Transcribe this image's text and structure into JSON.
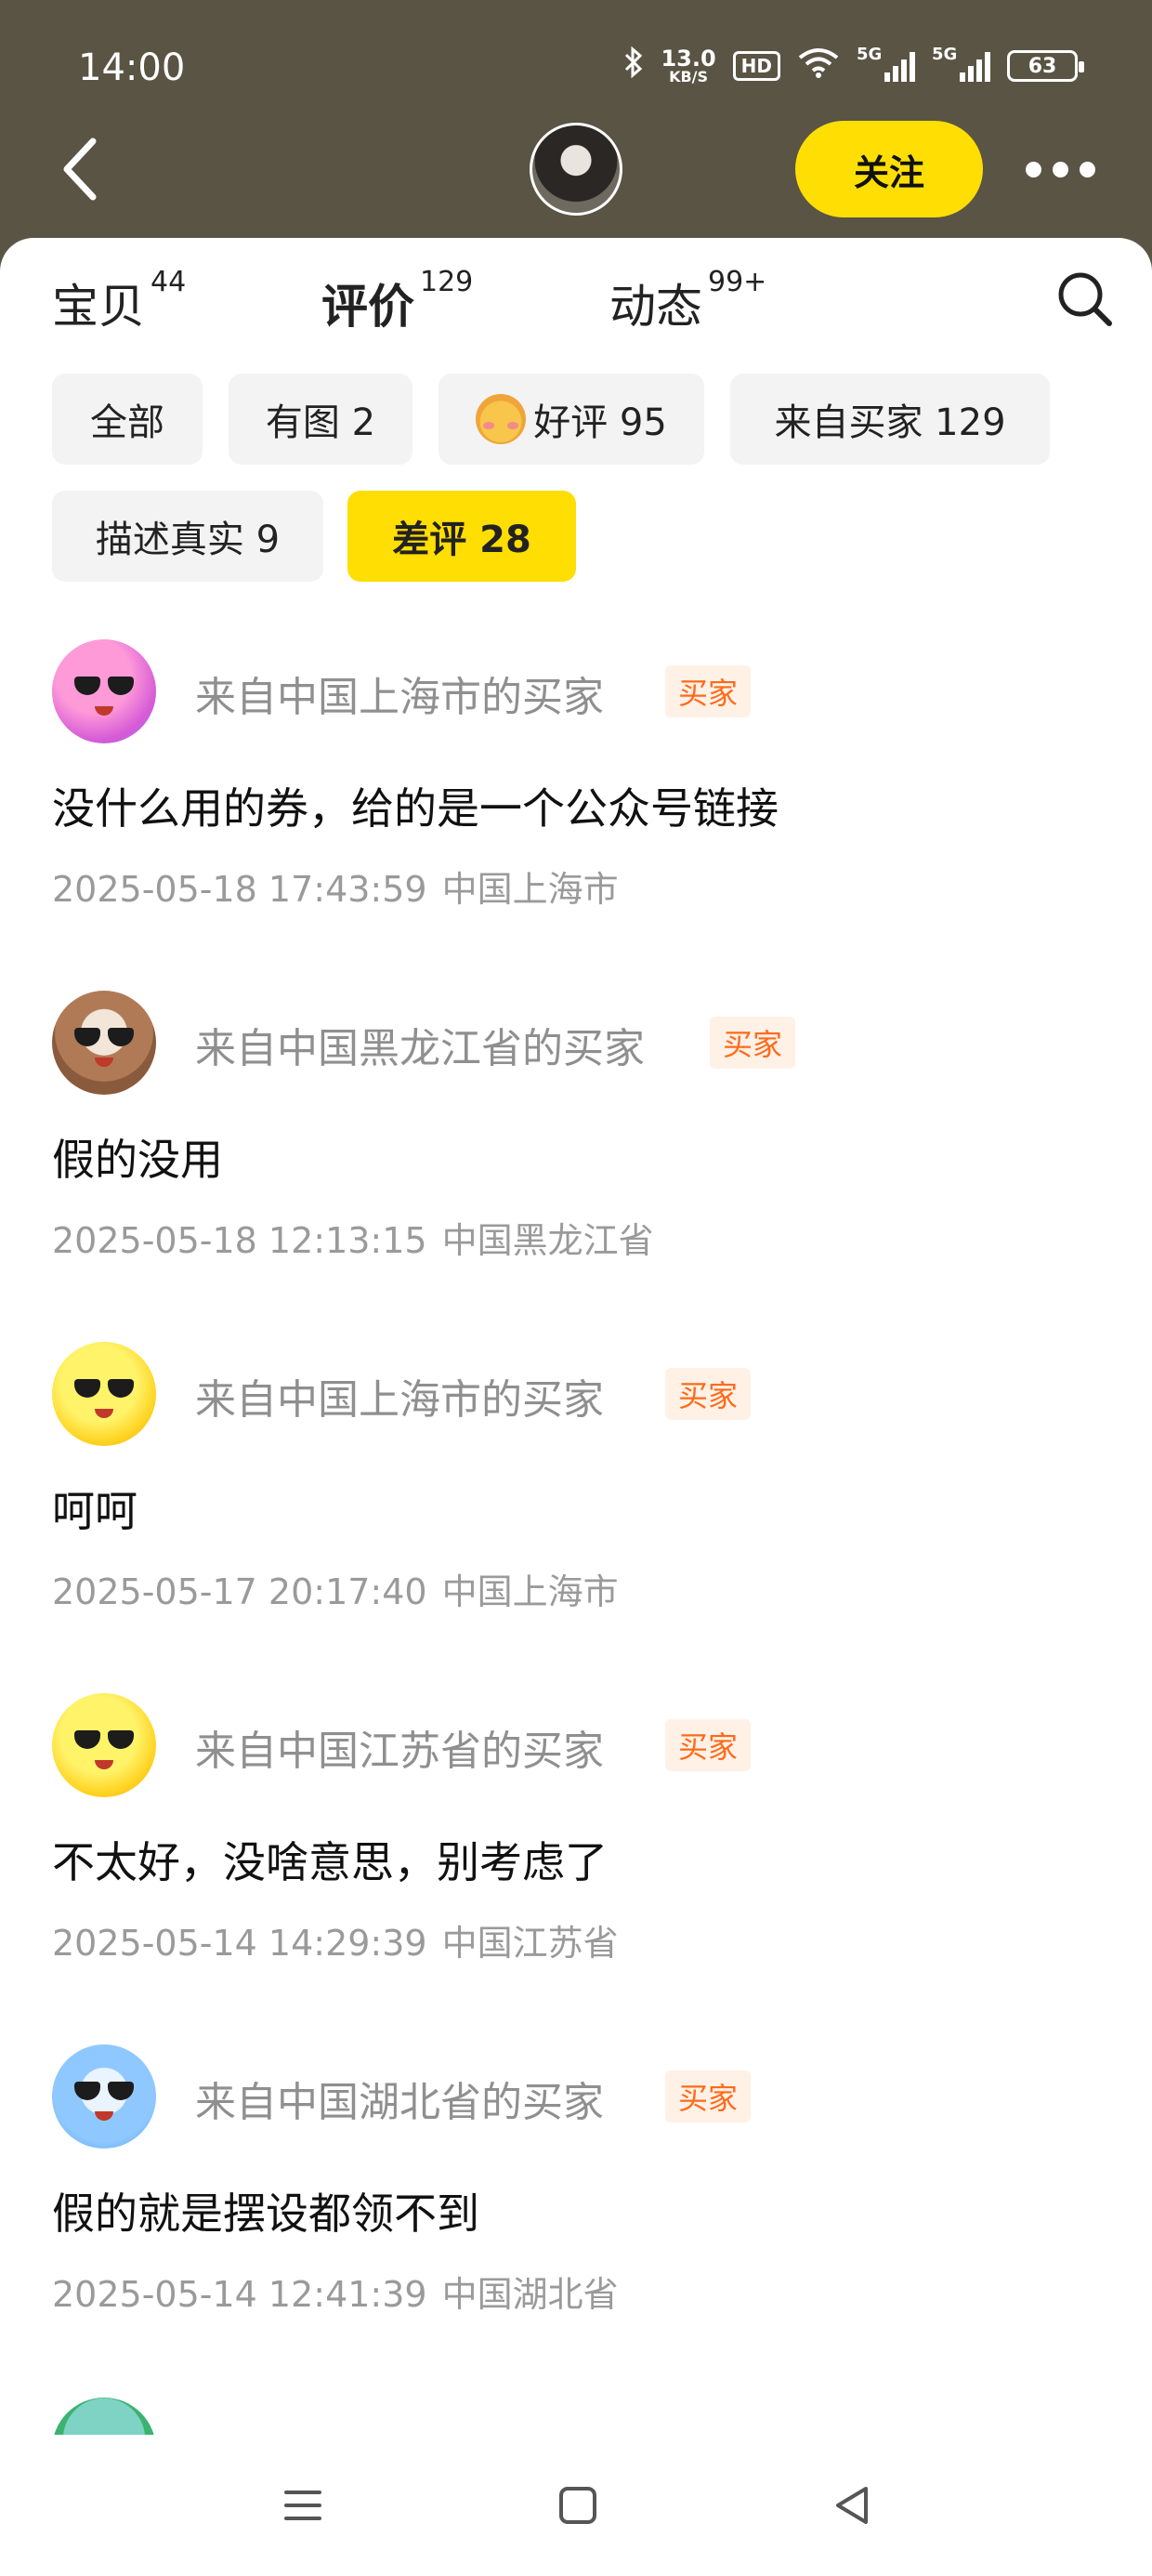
{
  "status_bar": {
    "time": "14:00",
    "net_speed_value": "13.0",
    "net_speed_unit": "KB/S",
    "hd_label": "HD",
    "signal1_label": "5G",
    "signal2_label": "5G",
    "battery": "63"
  },
  "header": {
    "follow_label": "关注"
  },
  "tabs": [
    {
      "label": "宝贝",
      "count": "44"
    },
    {
      "label": "评价",
      "count": "129"
    },
    {
      "label": "动态",
      "count": "99+"
    }
  ],
  "filters": [
    {
      "label": "全部"
    },
    {
      "label": "有图 2"
    },
    {
      "label": "好评 95"
    },
    {
      "label": "来自买家 129"
    },
    {
      "label": "描述真实 9"
    },
    {
      "label": "差评 28"
    }
  ],
  "reviews": [
    {
      "name": "来自中国上海市的买家",
      "badge": "买家",
      "text": "没什么用的券，给的是一个公众号链接",
      "time": "2025-05-18 17:43:59",
      "location": "中国上海市"
    },
    {
      "name": "来自中国黑龙江省的买家",
      "badge": "买家",
      "text": "假的没用",
      "time": "2025-05-18 12:13:15",
      "location": "中国黑龙江省"
    },
    {
      "name": "来自中国上海市的买家",
      "badge": "买家",
      "text": "呵呵",
      "time": "2025-05-17 20:17:40",
      "location": "中国上海市"
    },
    {
      "name": "来自中国江苏省的买家",
      "badge": "买家",
      "text": "不太好，没啥意思，别考虑了",
      "time": "2025-05-14 14:29:39",
      "location": "中国江苏省"
    },
    {
      "name": "来自中国湖北省的买家",
      "badge": "买家",
      "text": "假的就是摆设都领不到",
      "time": "2025-05-14 12:41:39",
      "location": "中国湖北省"
    }
  ],
  "colors": {
    "accent": "#ffde03",
    "header_bg": "#5a5444",
    "badge_text": "#ff6a1a",
    "badge_bg": "#fff1e6"
  }
}
